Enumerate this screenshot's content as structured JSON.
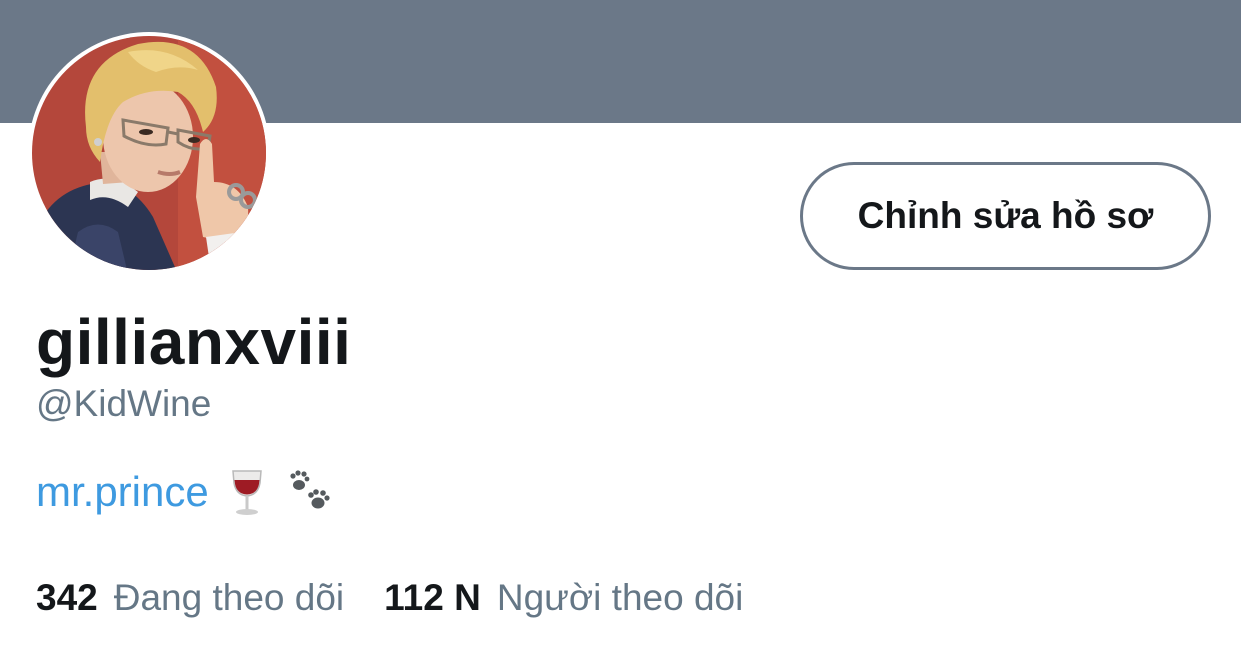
{
  "colors": {
    "banner": "#6b7888",
    "link": "#3e9ae0",
    "secondary_text": "#657786",
    "primary_text": "#14171a"
  },
  "profile": {
    "display_name": "gillianxviii",
    "handle": "@KidWine",
    "bio": {
      "link_text": "mr.prince",
      "emojis": [
        "wine-glass-emoji",
        "paw-prints-emoji"
      ]
    },
    "edit_button_label": "Chỉnh sửa hồ sơ"
  },
  "stats": {
    "following": {
      "count": "342",
      "label": "Đang theo dõi"
    },
    "followers": {
      "count": "112 N",
      "label": "Người theo dõi"
    }
  }
}
